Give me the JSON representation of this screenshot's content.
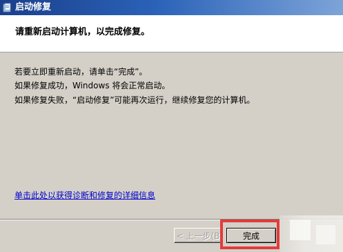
{
  "window": {
    "title": "启动修复",
    "icon": "app-icon"
  },
  "header": {
    "title": "请重新启动计算机，以完成修复。"
  },
  "body": {
    "line1": "若要立即重新启动，请单击“完成”。",
    "line2": "如果修复成功，Windows 将会正常启动。",
    "line3": "如果修复失败，“启动修复”可能再次运行，继续修复您的计算机。"
  },
  "links": {
    "details": "单击此处以获得诊断和修复的详细信息"
  },
  "buttons": {
    "back_label": "< 上一步(B",
    "finish_label": "完成"
  },
  "colors": {
    "titlebar_start": "#1b3f8b",
    "titlebar_end": "#7da4d8",
    "dialog_bg": "#d4d0c8",
    "link": "#0000cc",
    "highlight": "#e23b3b"
  }
}
